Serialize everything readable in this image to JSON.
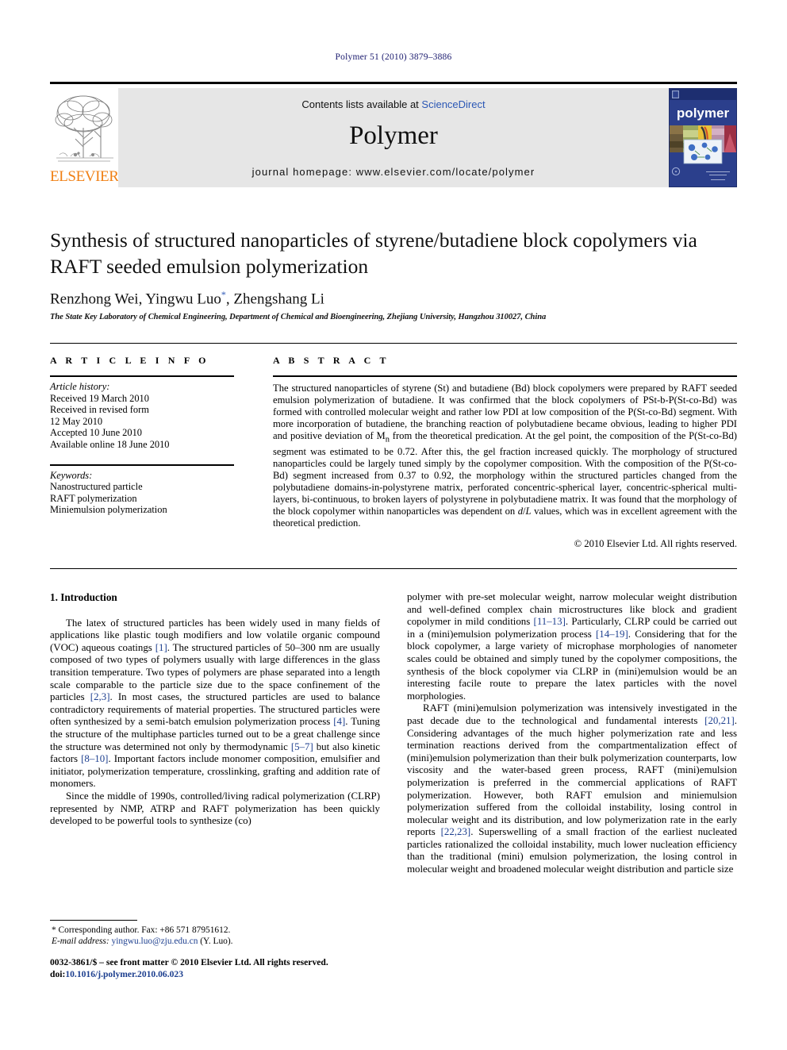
{
  "running_head": "Polymer 51 (2010) 3879–3886",
  "masthead": {
    "contents_prefix": "Contents lists available at ",
    "sciencedirect": "ScienceDirect",
    "journal_title": "Polymer",
    "homepage": "journal homepage: www.elsevier.com/locate/polymer",
    "elsevier_wordmark": "ELSEVIER",
    "cover_wordmark": "polymer",
    "accent_orange": "#F07F13",
    "link_blue": "#2b57b5",
    "band_gray": "#e6e6e6",
    "cover_blue": "#2b3f8c"
  },
  "article": {
    "title": "Synthesis of structured nanoparticles of styrene/butadiene block copolymers via RAFT seeded emulsion polymerization",
    "authors": "Renzhong Wei, Yingwu Luo",
    "authors_tail": ", Zhengshang Li",
    "author_star": "*",
    "affiliation": "The State Key Laboratory of Chemical Engineering, Department of Chemical and Bioengineering, Zhejiang University, Hangzhou 310027, China"
  },
  "info": {
    "heading": "A R T I C L E   I N F O",
    "history_label": "Article history:",
    "history": [
      "Received 19 March 2010",
      "Received in revised form",
      "12 May 2010",
      "Accepted 10 June 2010",
      "Available online 18 June 2010"
    ],
    "keywords_label": "Keywords:",
    "keywords": [
      "Nanostructured particle",
      "RAFT polymerization",
      "Miniemulsion polymerization"
    ]
  },
  "abstract": {
    "heading": "A B S T R A C T",
    "text": "The structured nanoparticles of styrene (St) and butadiene (Bd) block copolymers were prepared by RAFT seeded emulsion polymerization of butadiene. It was confirmed that the block copolymers of PSt-b-P(St-co-Bd) was formed with controlled molecular weight and rather low PDI at low composition of the P(St-co-Bd) segment. With more incorporation of butadiene, the branching reaction of polybutadiene became obvious, leading to higher PDI and positive deviation of Mn from the theoretical predication. At the gel point, the composition of the P(St-co-Bd) segment was estimated to be 0.72. After this, the gel fraction increased quickly. The morphology of structured nanoparticles could be largely tuned simply by the copolymer composition. With the composition of the P(St-co-Bd) segment increased from 0.37 to 0.92, the morphology within the structured particles changed from the polybutadiene domains-in-polystyrene matrix, perforated concentric-spherical layer, concentric-spherical multi-layers, bi-continuous, to broken layers of polystyrene in polybutadiene matrix. It was found that the morphology of the block copolymer within nanoparticles was dependent on d/L values, which was in excellent agreement with the theoretical prediction.",
    "copyright": "© 2010 Elsevier Ltd. All rights reserved."
  },
  "body": {
    "section_heading": "1. Introduction",
    "left_paragraphs": [
      "The latex of structured particles has been widely used in many fields of applications like plastic tough modifiers and low volatile organic compound (VOC) aqueous coatings [1]. The structured particles of 50–300 nm are usually composed of two types of polymers usually with large differences in the glass transition temperature. Two types of polymers are phase separated into a length scale comparable to the particle size due to the space confinement of the particles [2,3]. In most cases, the structured particles are used to balance contradictory requirements of material properties. The structured particles were often synthesized by a semi-batch emulsion polymerization process [4]. Tuning the structure of the multiphase particles turned out to be a great challenge since the structure was determined not only by thermodynamic [5–7] but also kinetic factors [8–10]. Important factors include monomer composition, emulsifier and initiator, polymerization temperature, crosslinking, grafting and addition rate of monomers.",
      "Since the middle of 1990s, controlled/living radical polymerization (CLRP) represented by NMP, ATRP and RAFT polymerization has been quickly developed to be powerful tools to synthesize (co)"
    ],
    "right_paragraphs": [
      "polymer with pre-set molecular weight, narrow molecular weight distribution and well-defined complex chain microstructures like block and gradient copolymer in mild conditions [11–13]. Particularly, CLRP could be carried out in a (mini)emulsion polymerization process [14–19]. Considering that for the block copolymer, a large variety of microphase morphologies of nanometer scales could be obtained and simply tuned by the copolymer compositions, the synthesis of the block copolymer via CLRP in (mini)emulsion would be an interesting facile route to prepare the latex particles with the novel morphologies.",
      "RAFT (mini)emulsion polymerization was intensively investigated in the past decade due to the technological and fundamental interests [20,21]. Considering advantages of the much higher polymerization rate and less termination reactions derived from the compartmentalization effect of (mini)emulsion polymerization than their bulk polymerization counterparts, low viscosity and the water-based green process, RAFT (mini)emulsion polymerization is preferred in the commercial applications of RAFT polymerization. However, both RAFT emulsion and miniemulsion polymerization suffered from the colloidal instability, losing control in molecular weight and its distribution, and low polymerization rate in the early reports [22,23]. Superswelling of a small fraction of the earliest nucleated particles rationalized the colloidal instability, much lower nucleation efficiency than the traditional (mini) emulsion polymerization, the losing control in molecular weight and broadened molecular weight distribution and particle size"
    ]
  },
  "footnote": {
    "corresponding": "* Corresponding author. Fax: +86 571 87951612.",
    "email_label": "E-mail address:",
    "email": "yingwu.luo@zju.edu.cn",
    "email_owner": "(Y. Luo)."
  },
  "imprint": {
    "front_matter": "0032-3861/$ – see front matter © 2010 Elsevier Ltd. All rights reserved.",
    "doi_label": "doi:",
    "doi": "10.1016/j.polymer.2010.06.023"
  }
}
